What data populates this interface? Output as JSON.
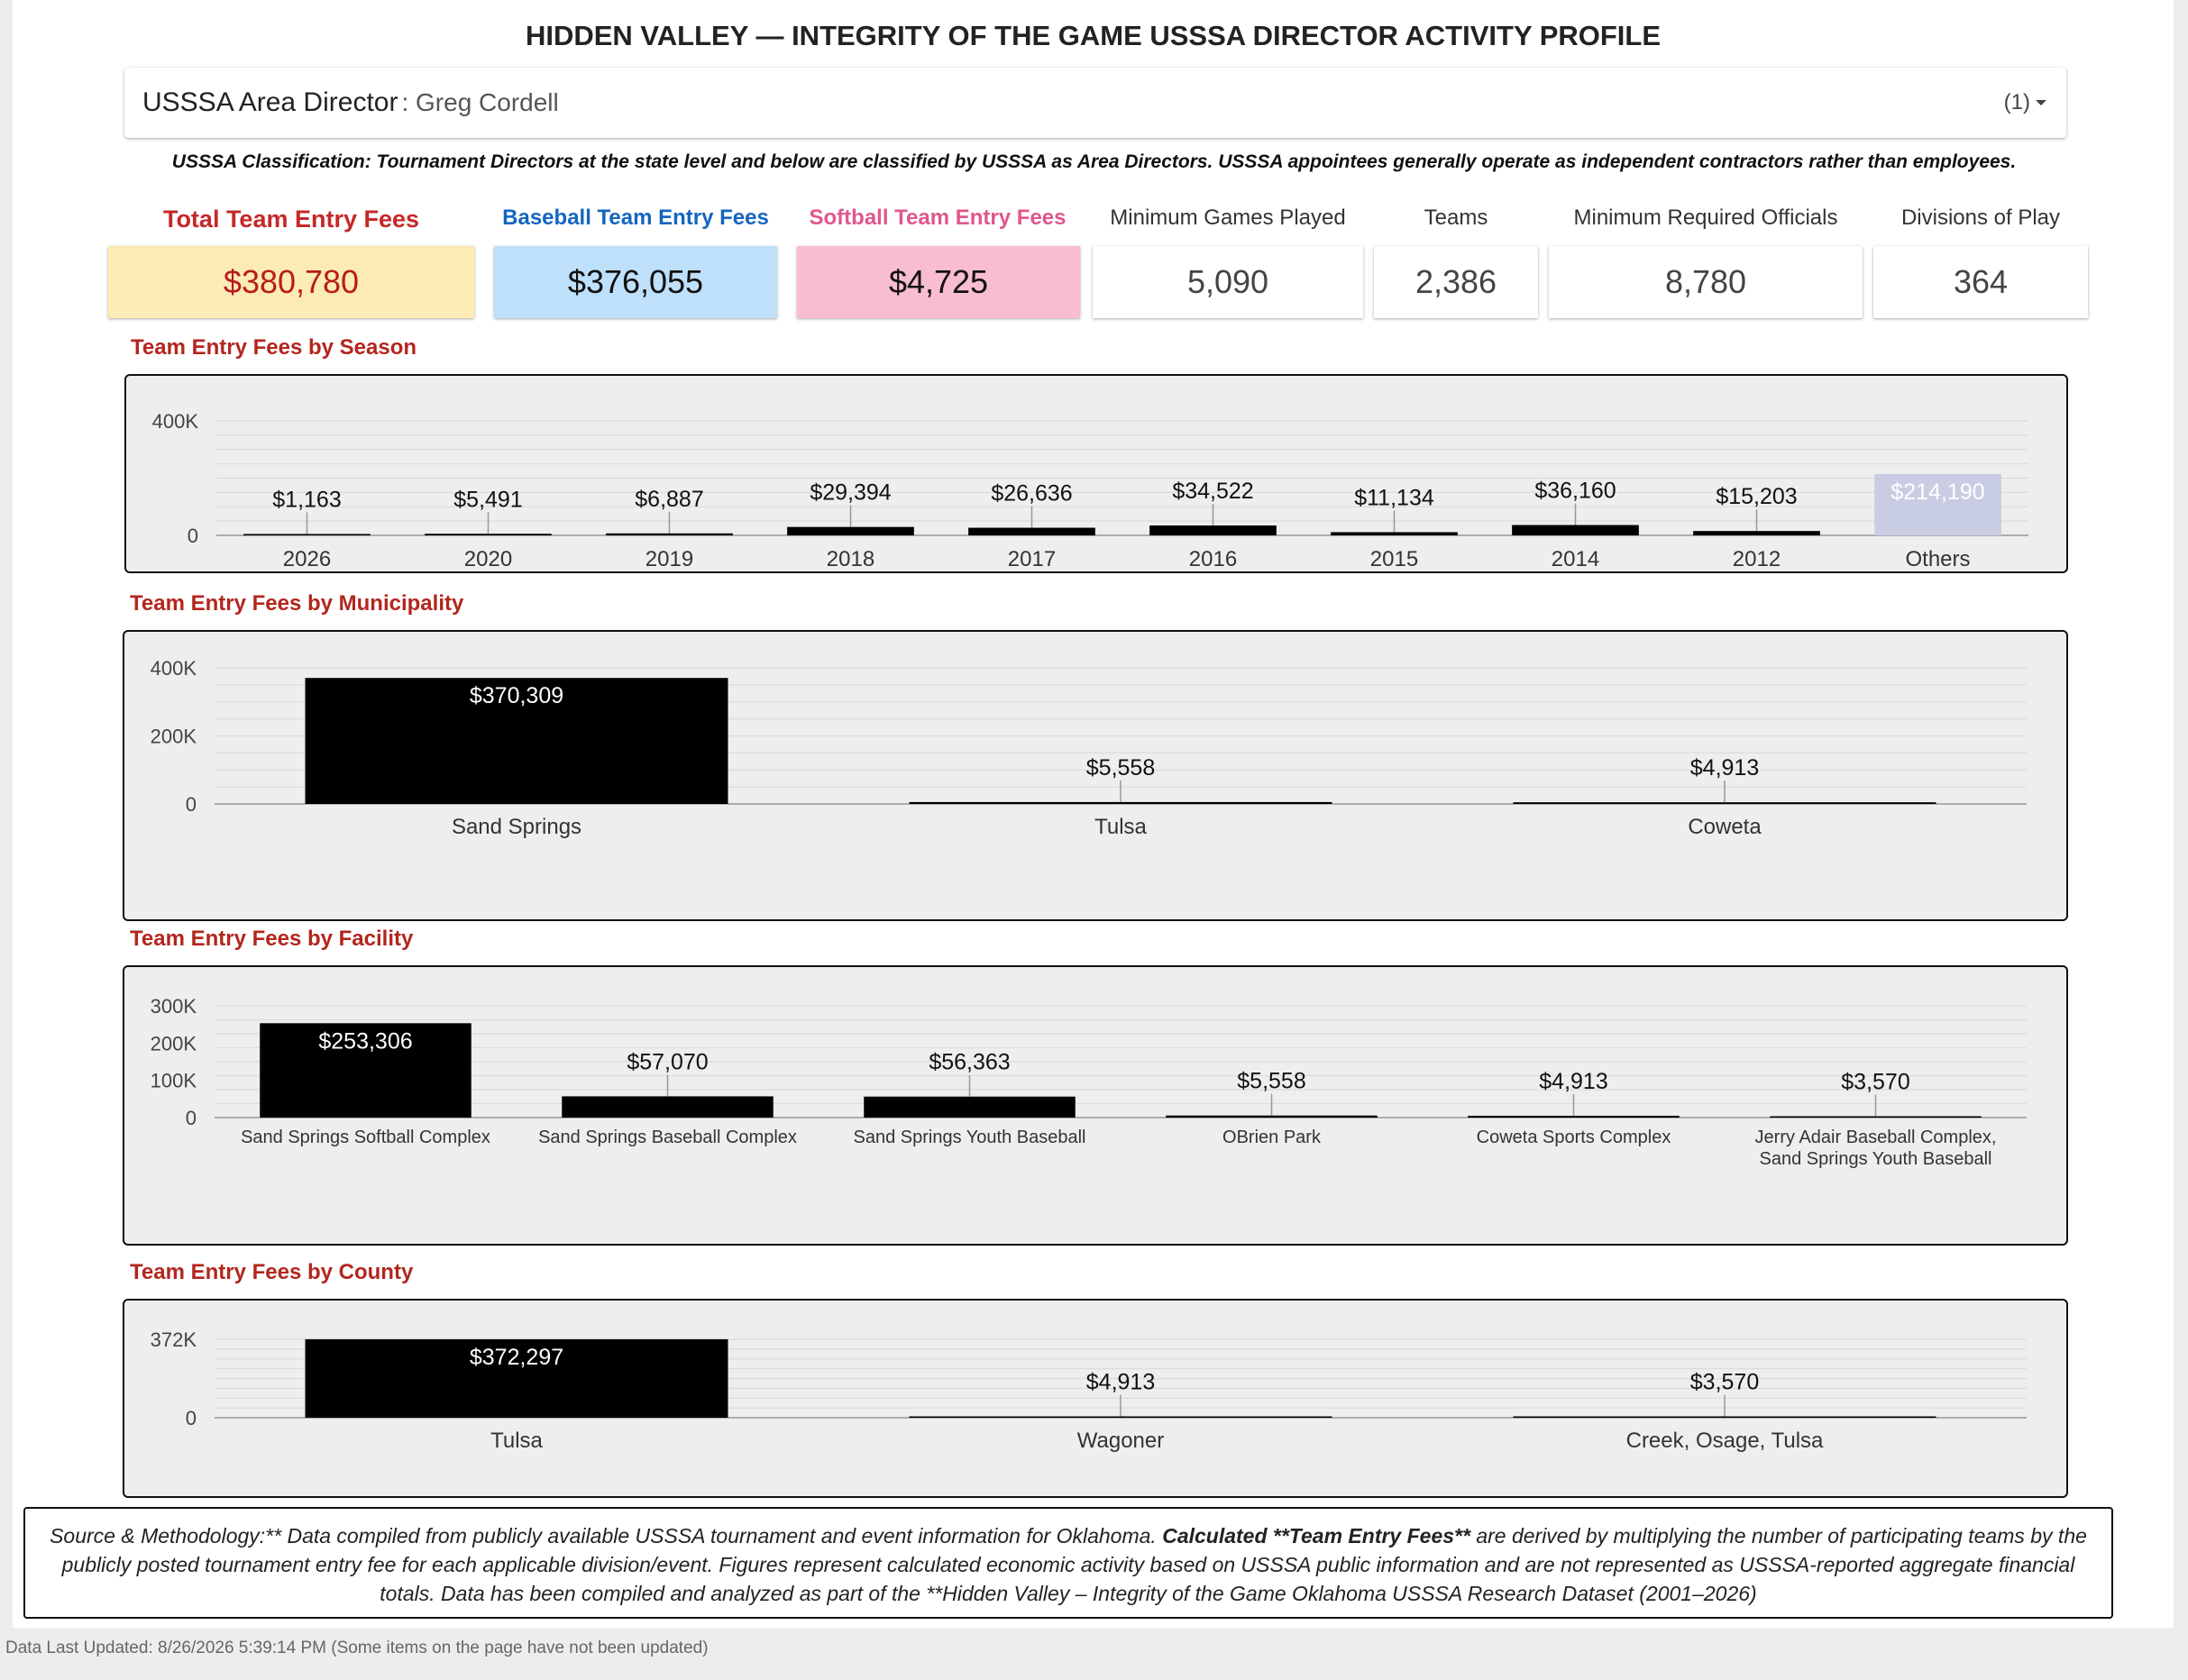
{
  "header": {
    "title": "HIDDEN VALLEY — INTEGRITY OF THE GAME USSSA DIRECTOR ACTIVITY PROFILE"
  },
  "director_filter": {
    "label": "USSSA Area Director",
    "value": ": Greg Cordell",
    "count": "(1)"
  },
  "classification_note": "USSSA Classification: Tournament Directors at the state level and below are classified by USSSA as Area Directors. USSSA appointees generally operate as independent contractors rather than employees.",
  "kpis": [
    {
      "label": "Total Team Entry Fees",
      "value": "$380,780",
      "label_color": "#c62828",
      "bg": "#fcebb4",
      "value_color": "#b71c1c"
    },
    {
      "label": "Baseball Team Entry Fees",
      "value": "$376,055",
      "label_color": "#1565c0",
      "bg": "#bfe0fa",
      "value_color": "#111111"
    },
    {
      "label": "Softball Team Entry Fees",
      "value": "$4,725",
      "label_color": "#e0578d",
      "bg": "#f8bcd3",
      "value_color": "#111111"
    },
    {
      "label": "Minimum Games Played",
      "value": "5,090",
      "label_color": "#333333",
      "bg": "#ffffff",
      "value_color": "#444444"
    },
    {
      "label": "Teams",
      "value": "2,386",
      "label_color": "#333333",
      "bg": "#ffffff",
      "value_color": "#444444"
    },
    {
      "label": "Minimum Required Officials",
      "value": "8,780",
      "label_color": "#333333",
      "bg": "#ffffff",
      "value_color": "#444444"
    },
    {
      "label": "Divisions of Play",
      "value": "364",
      "label_color": "#333333",
      "bg": "#ffffff",
      "value_color": "#444444"
    }
  ],
  "sections": {
    "season": "Team Entry Fees by Season",
    "municipality": "Team Entry Fees by Municipality",
    "facility": "Team Entry Fees by Facility",
    "county": "Team Entry Fees by County"
  },
  "chart_data": [
    {
      "id": "season",
      "type": "bar",
      "categories": [
        "2026",
        "2020",
        "2019",
        "2018",
        "2017",
        "2016",
        "2015",
        "2014",
        "2012",
        "Others"
      ],
      "values": [
        1163,
        5491,
        6887,
        29394,
        26636,
        34522,
        11134,
        36160,
        15203,
        214190
      ],
      "value_labels": [
        "$1,163",
        "$5,491",
        "$6,887",
        "$29,394",
        "$26,636",
        "$34,522",
        "$11,134",
        "$36,160",
        "$15,203",
        "$214,190"
      ],
      "ylim": [
        0,
        400000
      ],
      "yticks": [
        {
          "v": 0,
          "label": "0"
        },
        {
          "v": 400000,
          "label": "400K"
        }
      ],
      "bar_color": "#000000",
      "others_color": "#c9cde3",
      "grid": true
    },
    {
      "id": "municipality",
      "type": "bar",
      "categories": [
        "Sand Springs",
        "Tulsa",
        "Coweta"
      ],
      "values": [
        370309,
        5558,
        4913
      ],
      "value_labels": [
        "$370,309",
        "$5,558",
        "$4,913"
      ],
      "ylim": [
        0,
        400000
      ],
      "yticks": [
        {
          "v": 0,
          "label": "0"
        },
        {
          "v": 200000,
          "label": "200K"
        },
        {
          "v": 400000,
          "label": "400K"
        }
      ],
      "bar_color": "#000000",
      "grid": true
    },
    {
      "id": "facility",
      "type": "bar",
      "categories": [
        "Sand Springs Softball Complex",
        "Sand Springs Baseball Complex",
        "Sand Springs Youth Baseball",
        "OBrien Park",
        "Coweta Sports Complex",
        "Jerry Adair Baseball Complex, Sand Springs Youth Baseball"
      ],
      "category_lines": [
        [
          "Sand Springs Softball Complex"
        ],
        [
          "Sand Springs Baseball Complex"
        ],
        [
          "Sand Springs Youth Baseball"
        ],
        [
          "OBrien Park"
        ],
        [
          "Coweta Sports Complex"
        ],
        [
          "Jerry Adair Baseball Complex,",
          "Sand Springs Youth Baseball"
        ]
      ],
      "values": [
        253306,
        57070,
        56363,
        5558,
        4913,
        3570
      ],
      "value_labels": [
        "$253,306",
        "$57,070",
        "$56,363",
        "$5,558",
        "$4,913",
        "$3,570"
      ],
      "ylim": [
        0,
        300000
      ],
      "yticks": [
        {
          "v": 0,
          "label": "0"
        },
        {
          "v": 100000,
          "label": "100K"
        },
        {
          "v": 200000,
          "label": "200K"
        },
        {
          "v": 300000,
          "label": "300K"
        }
      ],
      "bar_color": "#000000",
      "grid": true
    },
    {
      "id": "county",
      "type": "bar",
      "categories": [
        "Tulsa",
        "Wagoner",
        "Creek, Osage, Tulsa"
      ],
      "values": [
        372297,
        4913,
        3570
      ],
      "value_labels": [
        "$372,297",
        "$4,913",
        "$3,570"
      ],
      "ylim": [
        0,
        372000
      ],
      "yticks": [
        {
          "v": 0,
          "label": "0"
        },
        {
          "v": 372000,
          "label": "372K"
        }
      ],
      "bar_color": "#000000",
      "grid": true
    }
  ],
  "footer": {
    "part1": "Source & Methodology:** Data compiled from publicly available USSSA tournament and event information for Oklahoma. ",
    "part2": "Calculated **Team Entry Fees**",
    "part3": " are derived by multiplying the number of participating teams by the publicly posted tournament entry fee for each applicable division/event. Figures represent calculated economic activity based on USSSA public information and are not represented as USSSA-reported aggregate financial totals. Data has been compiled and analyzed as part of the **Hidden Valley – Integrity of the Game Oklahoma USSSA Research Dataset (2001–2026)"
  },
  "last_updated": "Data Last Updated: 8/26/2026 5:39:14 PM (Some items on the page have not been updated)"
}
